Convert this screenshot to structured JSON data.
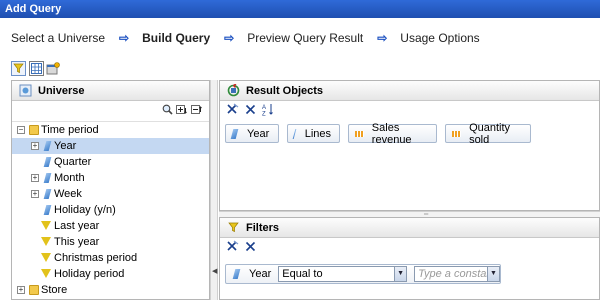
{
  "window": {
    "title": "Add Query"
  },
  "wizard": {
    "steps": [
      {
        "label": "Select a Universe",
        "active": false
      },
      {
        "label": "Build Query",
        "active": true
      },
      {
        "label": "Preview Query Result",
        "active": false
      },
      {
        "label": "Usage Options",
        "active": false
      }
    ],
    "arrow_glyph": "⇨"
  },
  "universe": {
    "title": "Universe",
    "tree": [
      {
        "label": "Time period",
        "type": "folder",
        "expand": "−"
      },
      {
        "label": "Year",
        "type": "dimension",
        "expand": "+",
        "selected": true
      },
      {
        "label": "Quarter",
        "type": "dimension",
        "expand": ""
      },
      {
        "label": "Month",
        "type": "dimension",
        "expand": "+"
      },
      {
        "label": "Week",
        "type": "dimension",
        "expand": "+"
      },
      {
        "label": "Holiday (y/n)",
        "type": "dimension",
        "expand": ""
      },
      {
        "label": "Last year",
        "type": "filter",
        "expand": ""
      },
      {
        "label": "This year",
        "type": "filter",
        "expand": ""
      },
      {
        "label": "Christmas period",
        "type": "filter",
        "expand": ""
      },
      {
        "label": "Holiday period",
        "type": "filter",
        "expand": ""
      },
      {
        "label": "Store",
        "type": "folder",
        "expand": "+"
      }
    ]
  },
  "results": {
    "title": "Result Objects",
    "objects": [
      {
        "label": "Year",
        "type": "dimension"
      },
      {
        "label": "Lines",
        "type": "dimension"
      },
      {
        "label": "Sales revenue",
        "type": "measure"
      },
      {
        "label": "Quantity sold",
        "type": "measure"
      }
    ]
  },
  "filters": {
    "title": "Filters",
    "row": {
      "object": "Year",
      "operator": "Equal to",
      "value_placeholder": "Type a constant"
    }
  },
  "colors": {
    "title_bar": "#1f4fb0",
    "selection": "#c4d8f2",
    "accent_arrow": "#1a4fc0",
    "measure": "#f0a020"
  }
}
